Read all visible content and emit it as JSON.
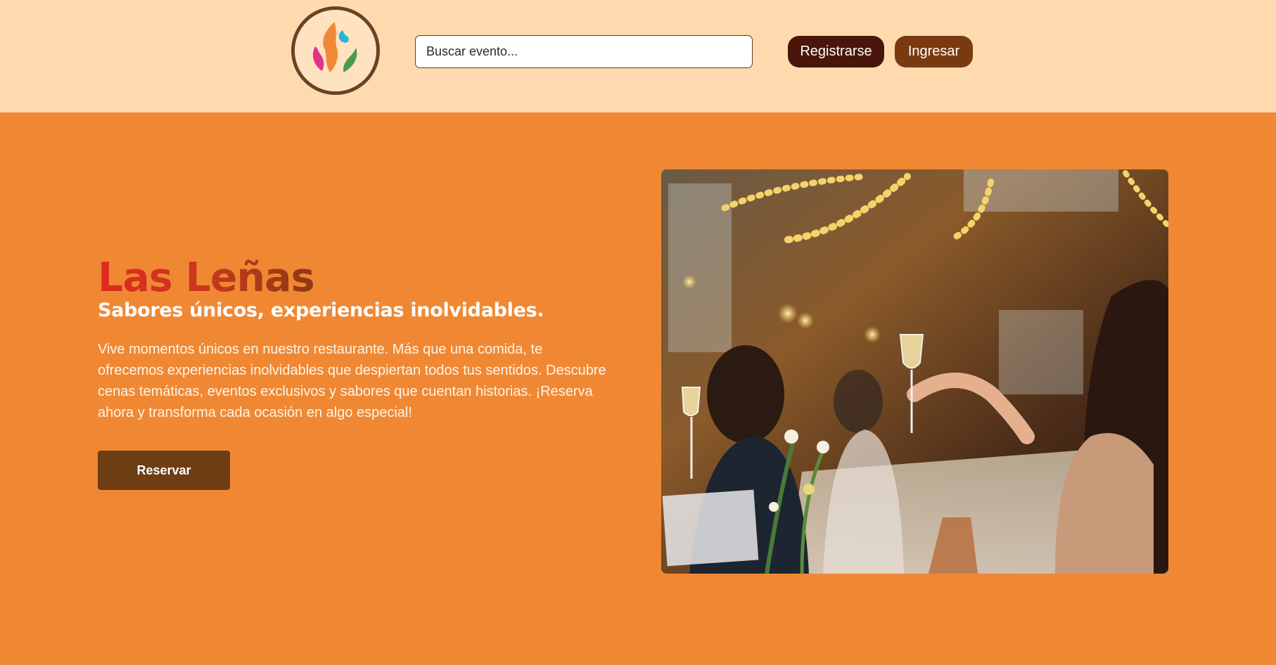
{
  "header": {
    "logo_name": "Las Leñas flame logo",
    "search": {
      "placeholder": "Buscar evento...",
      "value": ""
    },
    "register_label": "Registrarse",
    "login_label": "Ingresar"
  },
  "hero": {
    "title": "Las Leñas",
    "subtitle": "Sabores únicos, experiencias inolvidables.",
    "description": "Vive momentos únicos en nuestro restaurante. Más que una comida, te ofrecemos experiencias inolvidables que despiertan todos tus sentidos. Descubre cenas temáticas, eventos exclusivos y sabores que cuentan historias. ¡Reserva ahora y transforma cada ocasión en algo especial!",
    "reserve_label": "Reservar",
    "image_subject": "people toasting with champagne glasses at a banquet table under string lights"
  },
  "colors": {
    "header_bg": "#FFDAAE",
    "hero_bg": "#F08833",
    "register_btn": "#4A1609",
    "login_btn": "#7A3A10",
    "reserve_btn": "#6E3E13",
    "title_gradient_start": "#E02A22",
    "title_gradient_end": "#8A3A14"
  }
}
